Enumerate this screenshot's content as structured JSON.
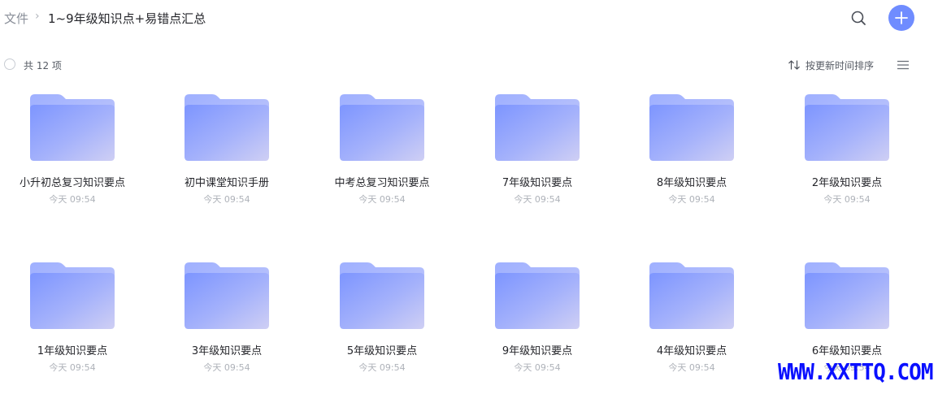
{
  "breadcrumb": {
    "root": "文件",
    "separator": "›",
    "current": "1~9年级知识点+易错点汇总"
  },
  "header": {
    "search_icon": "search-icon",
    "add_icon": "plus-icon",
    "accent_color": "#6f8cff"
  },
  "toolbar": {
    "count_label": "共 12 项",
    "sort_label": "按更新时间排序",
    "sort_icon": "sort-arrows-icon",
    "view_icon": "list-view-icon"
  },
  "items": [
    {
      "name": "小升初总复习知识要点",
      "time": "今天 09:54"
    },
    {
      "name": "初中课堂知识手册",
      "time": "今天 09:54"
    },
    {
      "name": "中考总复习知识要点",
      "time": "今天 09:54"
    },
    {
      "name": "7年级知识要点",
      "time": "今天 09:54"
    },
    {
      "name": "8年级知识要点",
      "time": "今天 09:54"
    },
    {
      "name": "2年级知识要点",
      "time": "今天 09:54"
    },
    {
      "name": "1年级知识要点",
      "time": "今天 09:54"
    },
    {
      "name": "3年级知识要点",
      "time": "今天 09:54"
    },
    {
      "name": "5年级知识要点",
      "time": "今天 09:54"
    },
    {
      "name": "9年级知识要点",
      "time": "今天 09:54"
    },
    {
      "name": "4年级知识要点",
      "time": "今天 09:54"
    },
    {
      "name": "6年级知识要点",
      "time": "今天 09:54"
    }
  ],
  "folder_icon": "folder-icon",
  "watermark": "WWW.XXTTQ.COM"
}
